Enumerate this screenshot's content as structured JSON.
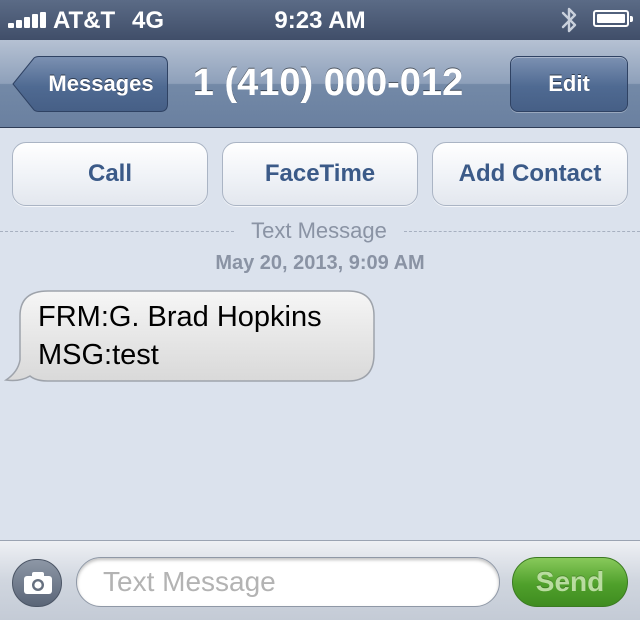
{
  "status_bar": {
    "carrier": "AT&T",
    "network": "4G",
    "time": "9:23 AM",
    "signal_bars": 5,
    "bluetooth_icon": "bluetooth-icon",
    "battery_level": 1.0
  },
  "nav": {
    "back_label": "Messages",
    "title": "1 (410) 000-012",
    "edit_label": "Edit"
  },
  "actions": {
    "call_label": "Call",
    "facetime_label": "FaceTime",
    "add_contact_label": "Add Contact"
  },
  "conversation": {
    "separator_label": "Text Message",
    "timestamp": "May 20, 2013, 9:09 AM",
    "messages": [
      {
        "direction": "incoming",
        "lines": [
          "FRM:G. Brad Hopkins",
          "MSG:test"
        ]
      }
    ]
  },
  "composer": {
    "camera_icon": "camera-icon",
    "placeholder": "Text Message",
    "value": "",
    "send_label": "Send"
  },
  "colors": {
    "nav_bar": "#7389a7",
    "background": "#dbe2ed",
    "action_text": "#3b5a88",
    "send_button": "#4fa02b"
  }
}
